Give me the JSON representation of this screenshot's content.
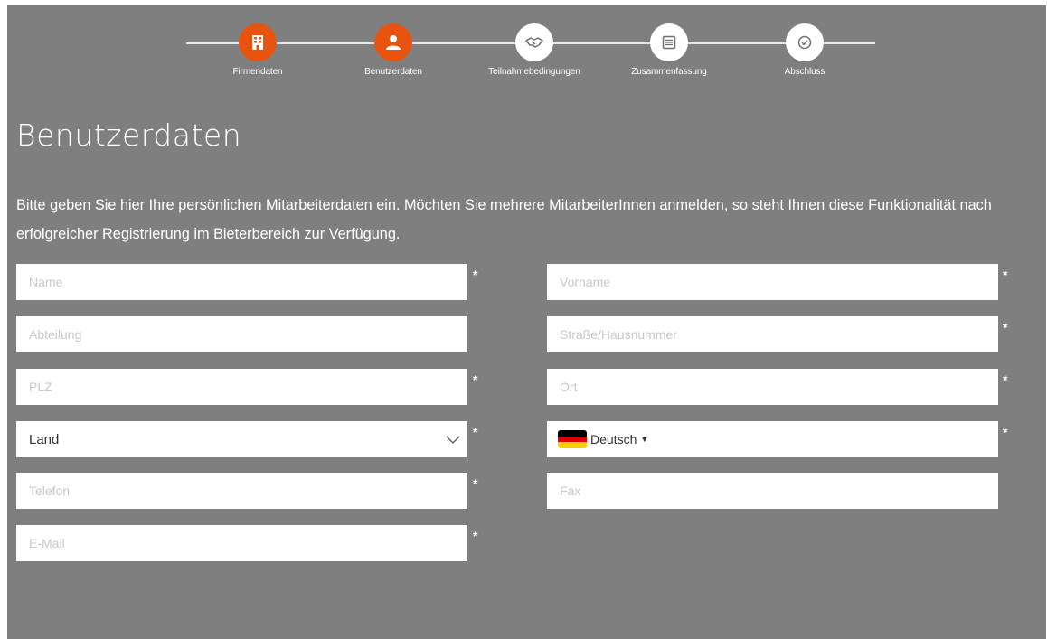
{
  "steps": [
    {
      "label": "Firmendaten",
      "icon": "building-icon",
      "active": true
    },
    {
      "label": "Benutzerdaten",
      "icon": "user-icon",
      "active": true
    },
    {
      "label": "Teilnahmebedingungen",
      "icon": "handshake-icon",
      "active": false
    },
    {
      "label": "Zusammenfassung",
      "icon": "list-icon",
      "active": false
    },
    {
      "label": "Abschluss",
      "icon": "check-icon",
      "active": false
    }
  ],
  "page": {
    "title": "Benutzerdaten",
    "intro": "Bitte geben Sie hier Ihre persönlichen Mitarbeiterdaten ein. Möchten Sie mehrere MitarbeiterInnen anmelden, so steht Ihnen diese Funktionalität nach erfolgreicher Registrierung im Bieterbereich zur Verfügung."
  },
  "form": {
    "name": {
      "placeholder": "Name",
      "required_mark": "*"
    },
    "vorname": {
      "placeholder": "Vorname",
      "required_mark": "*"
    },
    "abteilung": {
      "placeholder": "Abteilung"
    },
    "strasse": {
      "placeholder": "Straße/Hausnummer",
      "required_mark": "*"
    },
    "plz": {
      "placeholder": "PLZ",
      "required_mark": "*"
    },
    "ort": {
      "placeholder": "Ort",
      "required_mark": "*"
    },
    "land": {
      "value": "Land",
      "required_mark": "*"
    },
    "sprache": {
      "value": "Deutsch",
      "required_mark": "*"
    },
    "telefon": {
      "placeholder": "Telefon",
      "required_mark": "*"
    },
    "fax": {
      "placeholder": "Fax"
    },
    "email": {
      "placeholder": "E-Mail",
      "required_mark": "*"
    }
  },
  "colors": {
    "accent": "#e8540f",
    "panel": "#7f7f7f",
    "flag_black": "#000000",
    "flag_red": "#dd0000",
    "flag_gold": "#ffce00"
  }
}
